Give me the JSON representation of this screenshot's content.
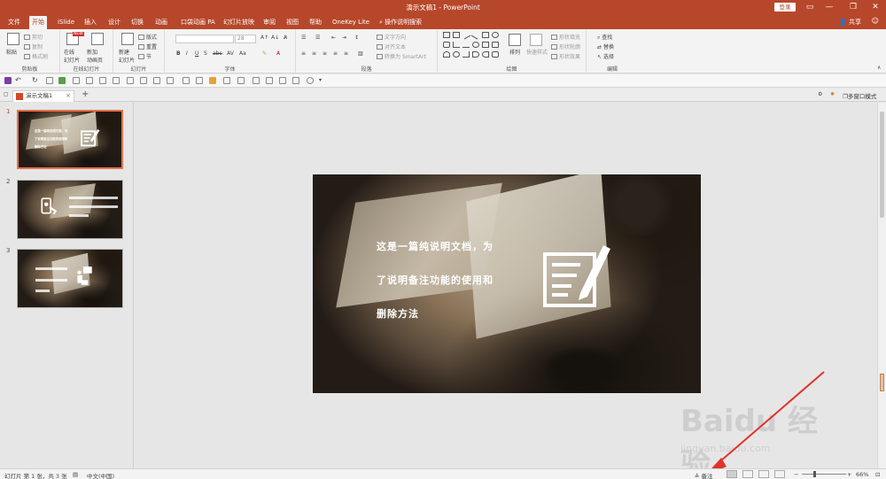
{
  "titlebar": {
    "title": "演示文稿1  -  PowerPoint",
    "login": "登录",
    "minimize": "—",
    "restore": "❐",
    "close": "✕"
  },
  "menu": {
    "tabs": [
      "文件",
      "开始",
      "iSlide",
      "插入",
      "设计",
      "切换",
      "动画",
      "口袋动画 PA",
      "幻灯片放映",
      "审阅",
      "视图",
      "帮助",
      "OneKey Lite"
    ],
    "active_index": 1,
    "search": "操作说明搜索",
    "share": "共享"
  },
  "ribbon": {
    "clipboard": {
      "paste": "粘贴",
      "cut": "剪切",
      "copy": "复制",
      "format_painter": "格式刷",
      "label": "剪贴板"
    },
    "online_slides": {
      "online": "在线\n幻灯片",
      "new_anim": "新加\n动画页",
      "label": "在线幻灯片",
      "badge": "NEW"
    },
    "slides": {
      "new_slide": "新建\n幻灯片",
      "layout": "版式",
      "reset": "重置",
      "section": "节",
      "label": "幻灯片"
    },
    "font": {
      "size": "28",
      "label": "字体"
    },
    "paragraph": {
      "text_direction": "文字方向",
      "align_text": "对齐文本",
      "smartart": "转换为 SmartArt",
      "label": "段落"
    },
    "drawing": {
      "arrange": "排列",
      "quick_styles": "快速样式",
      "shape_fill": "形状填充",
      "shape_outline": "形状轮廓",
      "shape_effect": "形状效果",
      "label": "绘图"
    },
    "editing": {
      "find": "查找",
      "replace": "替换",
      "select": "选择",
      "label": "编辑"
    }
  },
  "doctab": {
    "name": "演示文稿1",
    "close": "×",
    "new_tab": "+",
    "multi_window": "多窗口模式"
  },
  "slides": [
    {
      "num": "1",
      "lines": [
        "这是一篇纯说明文档，为",
        "了说明备注功能的使用和",
        "删除方法"
      ]
    },
    {
      "num": "2"
    },
    {
      "num": "3"
    }
  ],
  "status": {
    "slide_info": "幻灯片 第 1 张，共 3 张",
    "language": "中文(中国)",
    "notes": "备注",
    "zoom": "66%",
    "minus": "−",
    "plus": "+"
  },
  "watermark": {
    "brand": "Baidu 经验",
    "url": "jingyan.baidu.com"
  },
  "colors": {
    "accent": "#b7472a",
    "selection": "#e8714a",
    "arrow": "#e0332b"
  }
}
